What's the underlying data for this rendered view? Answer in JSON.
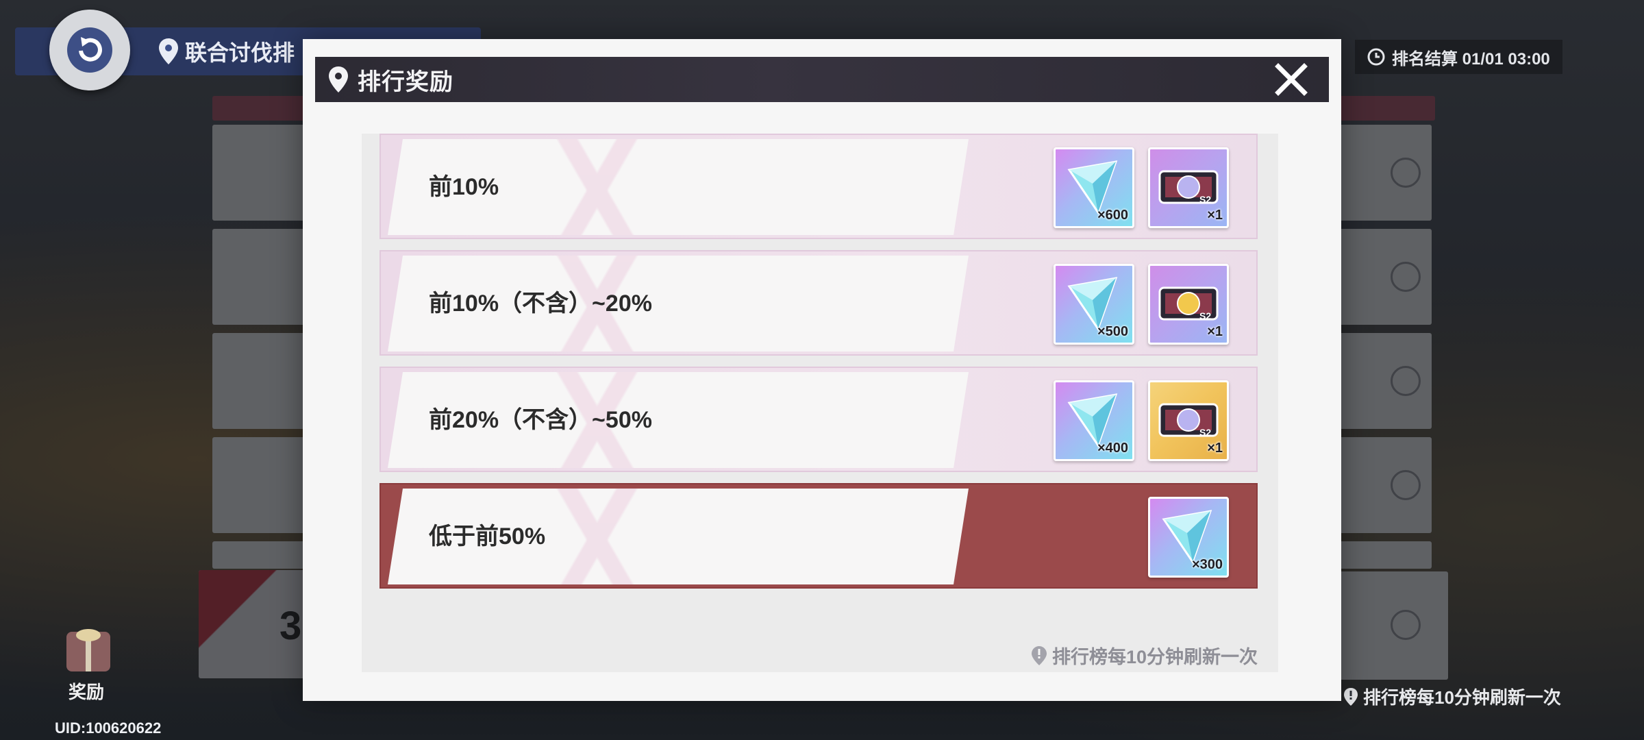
{
  "background": {
    "location_title": "联合讨伐排",
    "settlement_label": "排名结算 01/01 03:00",
    "rank_number": "3",
    "gift_label": "奖励",
    "uid_label": "UID:100620622",
    "refresh_note": "排行榜每10分钟刷新一次"
  },
  "modal": {
    "title": "排行奖励",
    "footnote": "排行榜每10分钟刷新一次",
    "tiers": [
      {
        "label": "前10%",
        "active": false,
        "rewards": [
          {
            "icon": "crystal-icon",
            "qty": "×600"
          },
          {
            "icon": "ticket-purple-s2-icon",
            "qty": "×1"
          }
        ]
      },
      {
        "label": "前10%（不含）~20%",
        "active": false,
        "rewards": [
          {
            "icon": "crystal-icon",
            "qty": "×500"
          },
          {
            "icon": "ticket-purple-gold-s2-icon",
            "qty": "×1"
          }
        ]
      },
      {
        "label": "前20%（不含）~50%",
        "active": false,
        "rewards": [
          {
            "icon": "crystal-icon",
            "qty": "×400"
          },
          {
            "icon": "ticket-gold-s2-icon",
            "qty": "×1"
          }
        ]
      },
      {
        "label": "低于前50%",
        "active": true,
        "rewards": [
          {
            "icon": "crystal-icon",
            "qty": "×300"
          }
        ]
      }
    ]
  },
  "colors": {
    "header_bg": "#2c2a33",
    "active_tier": "#9b4a4b",
    "tier_bg": "#ecdae8"
  }
}
